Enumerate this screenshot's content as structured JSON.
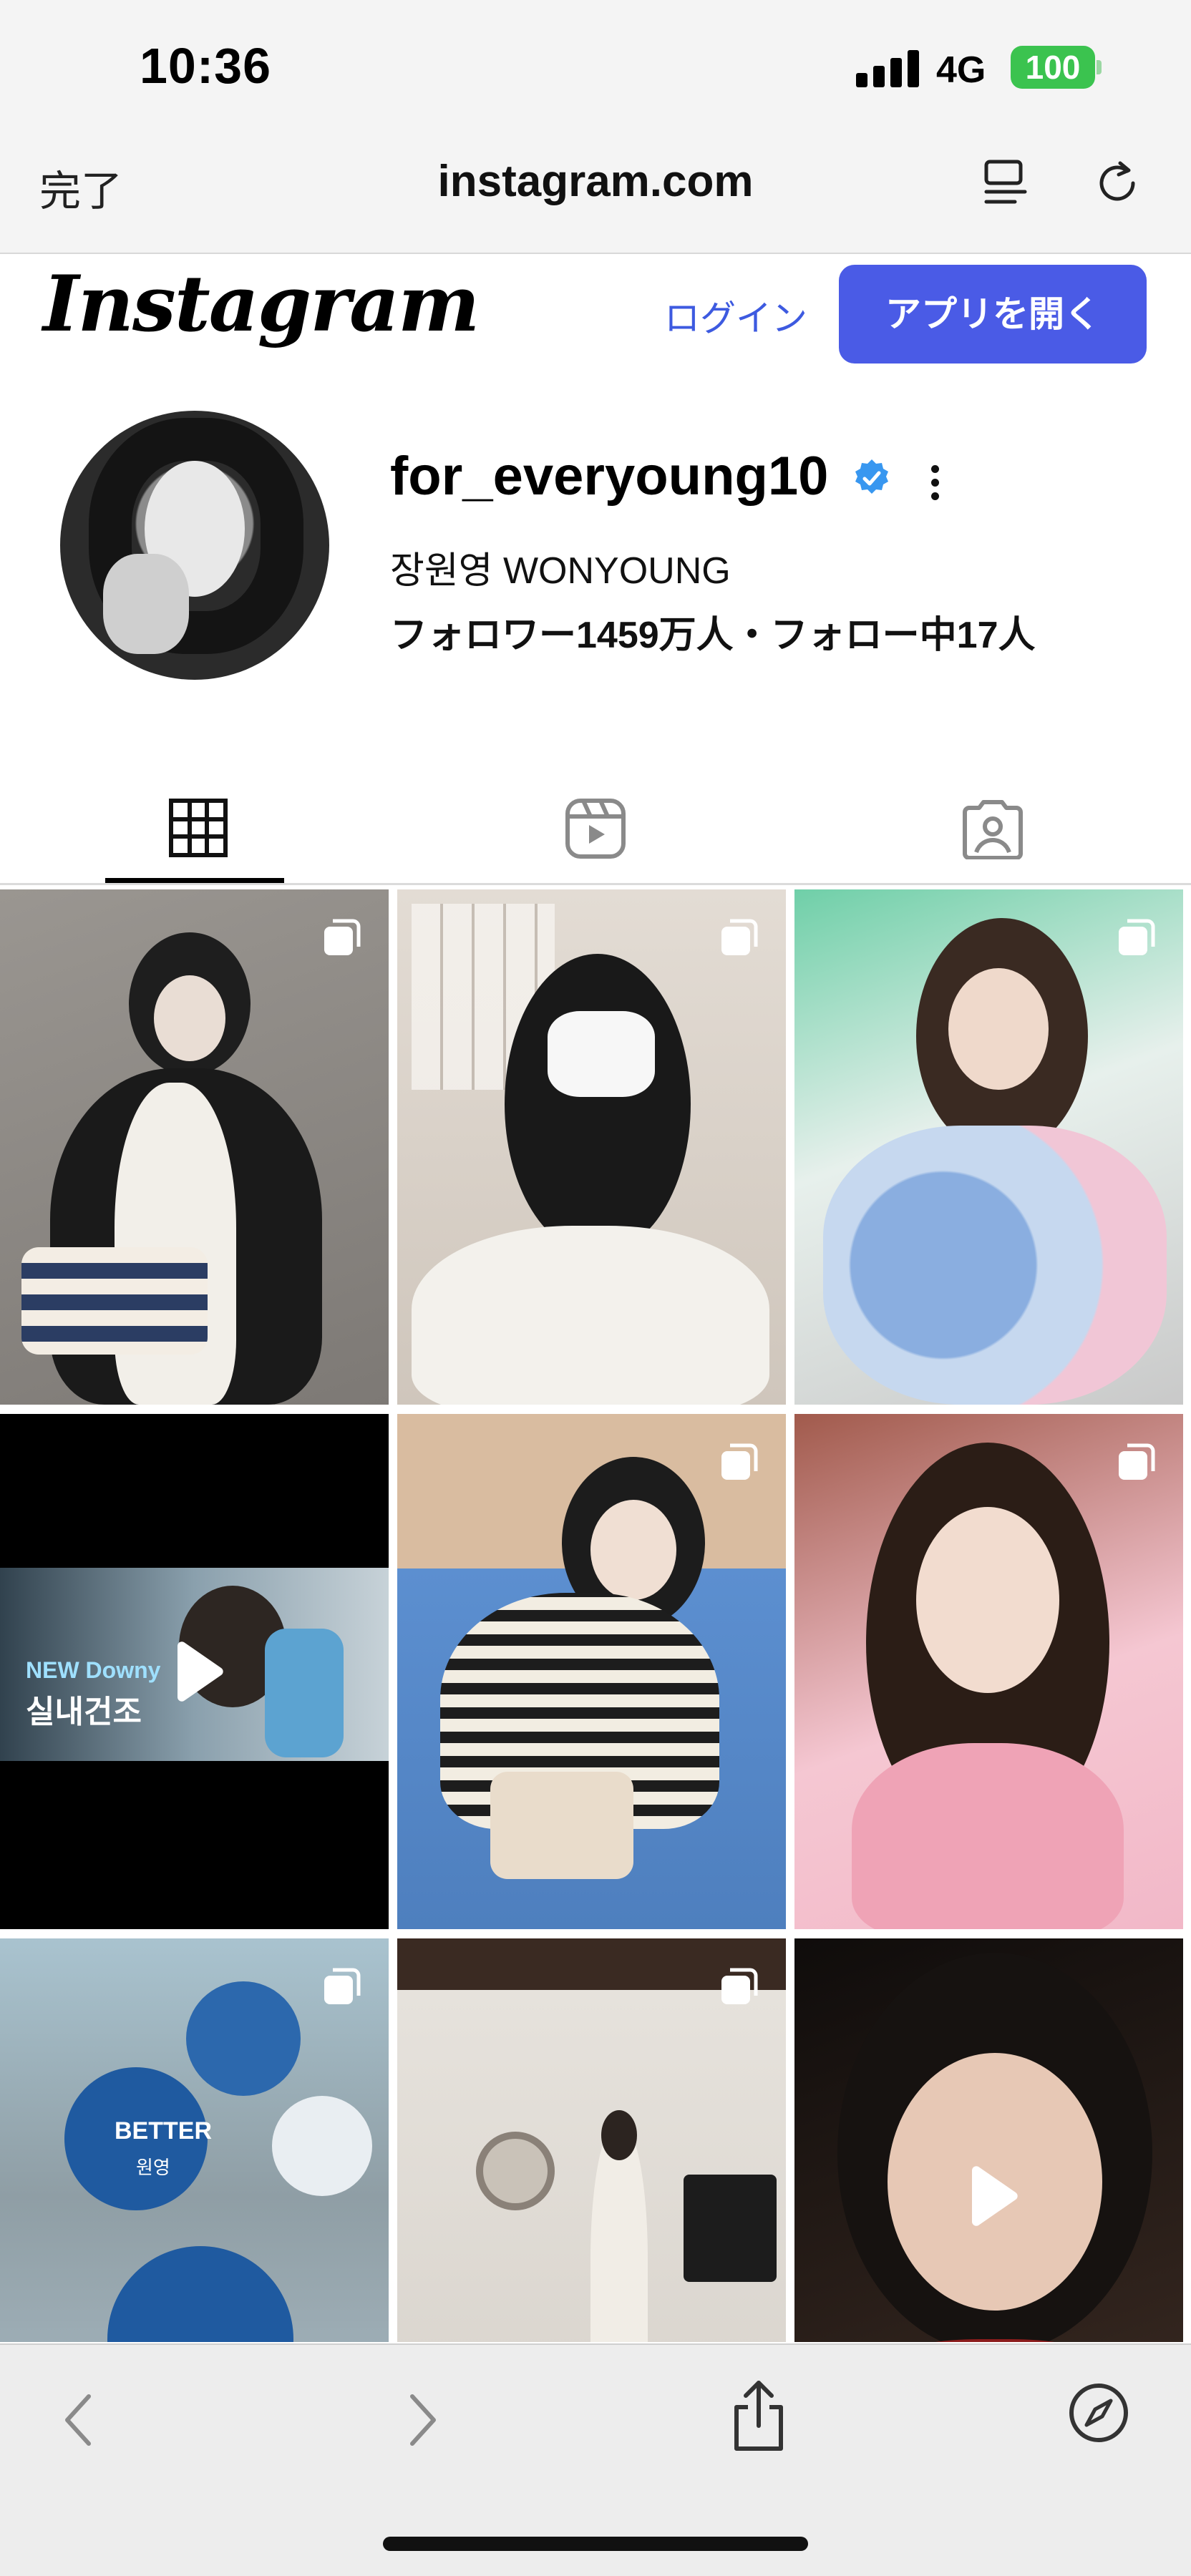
{
  "status_bar": {
    "time": "10:36",
    "network": "4G",
    "battery": "100"
  },
  "browser": {
    "done_label": "完了",
    "url": "instagram.com"
  },
  "header": {
    "logo_text": "Instagram",
    "login_label": "ログイン",
    "open_app_label": "アプリを開く"
  },
  "profile": {
    "username": "for_everyoung10",
    "verified": true,
    "full_name": "장원영 WONYOUNG",
    "stats": "フォロワー1459万人・フォロー中17人"
  },
  "tabs": [
    {
      "name": "posts",
      "icon": "grid-icon",
      "active": true
    },
    {
      "name": "reels",
      "icon": "reels-icon",
      "active": false
    },
    {
      "name": "tagged",
      "icon": "tagged-icon",
      "active": false
    }
  ],
  "posts": [
    {
      "type": "carousel",
      "palette": [
        "#8e8a86",
        "#2a2a2a",
        "#efe9e2"
      ]
    },
    {
      "type": "carousel",
      "palette": [
        "#dcd6cf",
        "#1b1b1b",
        "#f3f1ec"
      ]
    },
    {
      "type": "carousel",
      "palette": [
        "#b9d9d0",
        "#3a2a22",
        "#8aaee0"
      ]
    },
    {
      "type": "video",
      "palette": [
        "#000000",
        "#5a6f7c",
        "#c7d2d8"
      ],
      "overlay_text": [
        "NEW Downy",
        "실내건조"
      ]
    },
    {
      "type": "carousel",
      "palette": [
        "#d8b89a",
        "#5c8fd0",
        "#1c1c1c"
      ]
    },
    {
      "type": "carousel",
      "palette": [
        "#efa3b6",
        "#2b1d16",
        "#f1b9c6"
      ]
    },
    {
      "type": "carousel",
      "palette": [
        "#a9c3cf",
        "#1f5aa0",
        "#e9eef2"
      ],
      "overlay_text": [
        "BETTER",
        "원영"
      ]
    },
    {
      "type": "carousel",
      "palette": [
        "#e6e2dc",
        "#2c2420",
        "#f3efe9"
      ]
    },
    {
      "type": "video",
      "palette": [
        "#1a1412",
        "#c9a48c",
        "#3a2a22"
      ]
    }
  ],
  "colors": {
    "accent": "#4a5be6",
    "link": "#3d5ae0",
    "verified": "#3897f0",
    "battery": "#3bc34f"
  }
}
